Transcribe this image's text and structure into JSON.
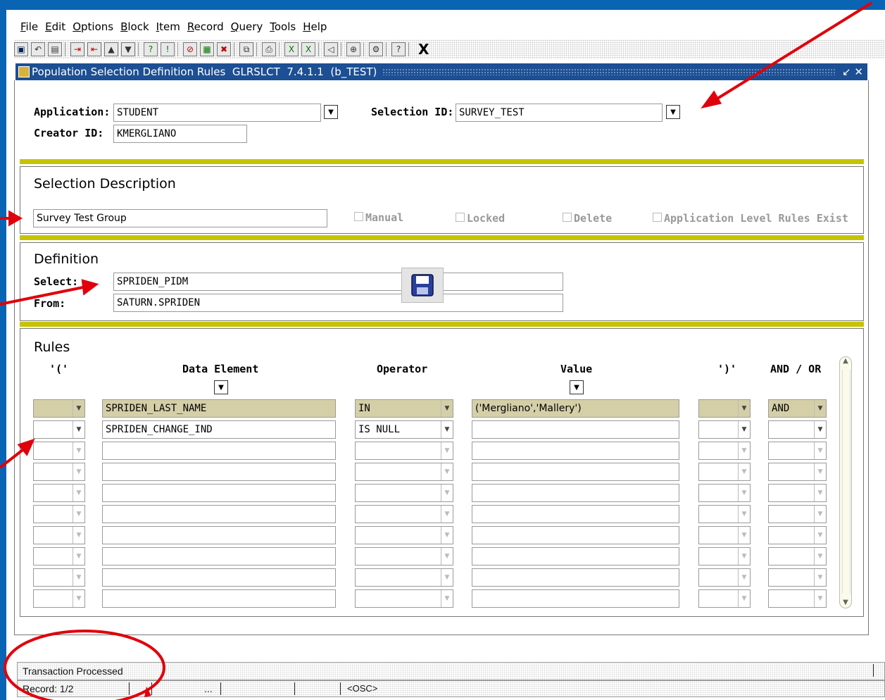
{
  "menu": [
    "File",
    "Edit",
    "Options",
    "Block",
    "Item",
    "Record",
    "Query",
    "Tools",
    "Help"
  ],
  "menu_underline": [
    "F",
    "E",
    "O",
    "B",
    "I",
    "R",
    "Q",
    "T",
    "H"
  ],
  "toolbar": {
    "exit_label": "X"
  },
  "window": {
    "title": "Population Selection Definition Rules  GLRSLCT  7.4.1.1  (b_TEST)",
    "controls": "↙ ✕"
  },
  "key_block": {
    "application_label": "Application:",
    "application_value": "STUDENT",
    "selection_id_label": "Selection ID:",
    "selection_id_value": "SURVEY_TEST",
    "creator_id_label": "Creator ID:",
    "creator_id_value": "KMERGLIANO"
  },
  "selection_description": {
    "title": "Selection Description",
    "value": "Survey Test Group",
    "manual": "Manual",
    "locked": "Locked",
    "delete": "Delete",
    "app_level": "Application Level Rules Exist"
  },
  "definition": {
    "title": "Definition",
    "select_label": "Select:",
    "select_value": "SPRIDEN_PIDM",
    "from_label": "From:",
    "from_value": "SATURN.SPRIDEN"
  },
  "rules": {
    "title": "Rules",
    "headers": {
      "open_paren": "'('",
      "data_element": "Data Element",
      "operator": "Operator",
      "value": "Value",
      "close_paren": "')'",
      "and_or": "AND / OR"
    },
    "rows": [
      {
        "open": "",
        "element": "SPRIDEN_LAST_NAME",
        "operator": "IN",
        "value": "('Mergliano','Mallery')",
        "close": "",
        "andor": "AND"
      },
      {
        "open": "",
        "element": "SPRIDEN_CHANGE_IND",
        "operator": "IS NULL",
        "value": "",
        "close": "",
        "andor": ""
      },
      {
        "open": "",
        "element": "",
        "operator": "",
        "value": "",
        "close": "",
        "andor": ""
      },
      {
        "open": "",
        "element": "",
        "operator": "",
        "value": "",
        "close": "",
        "andor": ""
      },
      {
        "open": "",
        "element": "",
        "operator": "",
        "value": "",
        "close": "",
        "andor": ""
      },
      {
        "open": "",
        "element": "",
        "operator": "",
        "value": "",
        "close": "",
        "andor": ""
      },
      {
        "open": "",
        "element": "",
        "operator": "",
        "value": "",
        "close": "",
        "andor": ""
      },
      {
        "open": "",
        "element": "",
        "operator": "",
        "value": "",
        "close": "",
        "andor": ""
      },
      {
        "open": "",
        "element": "",
        "operator": "",
        "value": "",
        "close": "",
        "andor": ""
      },
      {
        "open": "",
        "element": "",
        "operator": "",
        "value": "",
        "close": "",
        "andor": ""
      }
    ]
  },
  "status": {
    "message": "Transaction Processed",
    "record": "Record: 1/2",
    "ellipsis": "...",
    "osc": "<OSC>"
  },
  "colors": {
    "frame": "#0a64b4",
    "titlebar": "#1c4f94",
    "separator": "#c6c400",
    "highlight": "#d5cfa8",
    "arrow": "#e0000b"
  }
}
